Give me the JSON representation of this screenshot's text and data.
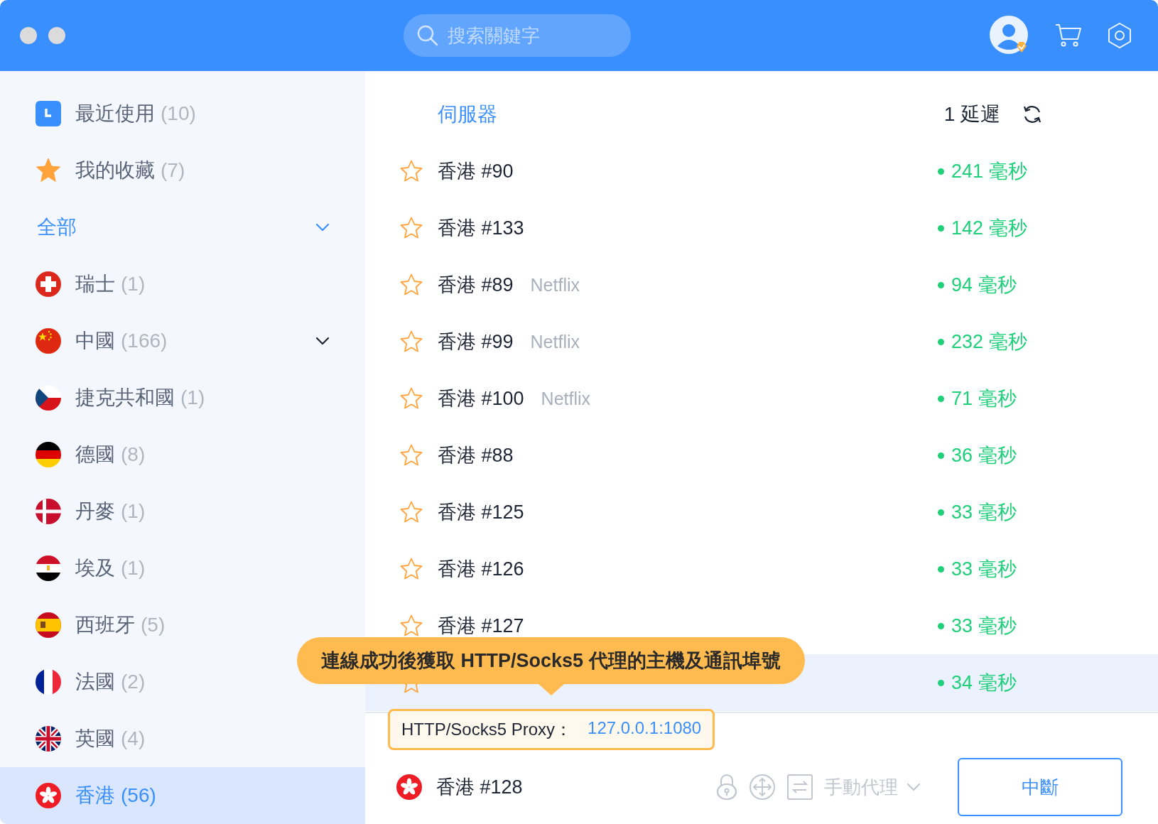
{
  "header": {
    "search": {
      "placeholder": "搜索關鍵字"
    }
  },
  "sidebar": {
    "items": [
      {
        "kind": "recent",
        "label": "最近使用",
        "count": "(10)",
        "selected": false
      },
      {
        "kind": "favorites",
        "label": "我的收藏",
        "count": "(7)",
        "selected": false
      },
      {
        "kind": "group",
        "label": "全部",
        "expanded": true
      },
      {
        "kind": "ch",
        "label": "瑞士",
        "count": "(1)",
        "selected": false
      },
      {
        "kind": "cn",
        "label": "中國",
        "count": "(166)",
        "selected": false,
        "expandable": true
      },
      {
        "kind": "cz",
        "label": "捷克共和國",
        "count": "(1)",
        "selected": false
      },
      {
        "kind": "de",
        "label": "德國",
        "count": "(8)",
        "selected": false
      },
      {
        "kind": "dk",
        "label": "丹麥",
        "count": "(1)",
        "selected": false
      },
      {
        "kind": "eg",
        "label": "埃及",
        "count": "(1)",
        "selected": false
      },
      {
        "kind": "es",
        "label": "西班牙",
        "count": "(5)",
        "selected": false
      },
      {
        "kind": "fr",
        "label": "法國",
        "count": "(2)",
        "selected": false
      },
      {
        "kind": "gb",
        "label": "英國",
        "count": "(4)",
        "selected": false
      },
      {
        "kind": "hk",
        "label": "香港",
        "count": "(56)",
        "selected": true
      }
    ]
  },
  "server_list": {
    "column_server": "伺服器",
    "column_latency": "1 延遲",
    "rows": [
      {
        "name": "香港 #90",
        "latency": "241 毫秒",
        "selected": false,
        "favorite": false
      },
      {
        "name": "香港 #133",
        "latency": "142 毫秒",
        "selected": false,
        "favorite": false
      },
      {
        "name": "香港 #89",
        "tag": "Netflix",
        "latency": "94 毫秒",
        "selected": false,
        "favorite": false
      },
      {
        "name": "香港 #99",
        "tag": "Netflix",
        "latency": "232 毫秒",
        "selected": false,
        "favorite": false
      },
      {
        "name": "香港 #100",
        "tag": "Netflix",
        "latency": "71 毫秒",
        "selected": false,
        "favorite": false
      },
      {
        "name": "香港 #88",
        "latency": "36 毫秒",
        "selected": false,
        "favorite": false
      },
      {
        "name": "香港 #125",
        "latency": "33 毫秒",
        "selected": false,
        "favorite": false
      },
      {
        "name": "香港 #126",
        "latency": "33 毫秒",
        "selected": false,
        "favorite": false
      },
      {
        "name": "香港 #127",
        "latency": "33 毫秒",
        "selected": false,
        "favorite": false
      },
      {
        "latency": "34 毫秒",
        "selected": true,
        "favorite": false
      }
    ]
  },
  "tooltip": "連線成功後獲取 HTTP/Socks5 代理的主機及通訊埠號",
  "proxy": {
    "label": "HTTP/Socks5 Proxy：",
    "address": "127.0.0.1:1080"
  },
  "footer": {
    "kind": "hk",
    "server": "香港 #128",
    "mode": "手動代理",
    "mode_disabled": true,
    "button": "中斷"
  }
}
